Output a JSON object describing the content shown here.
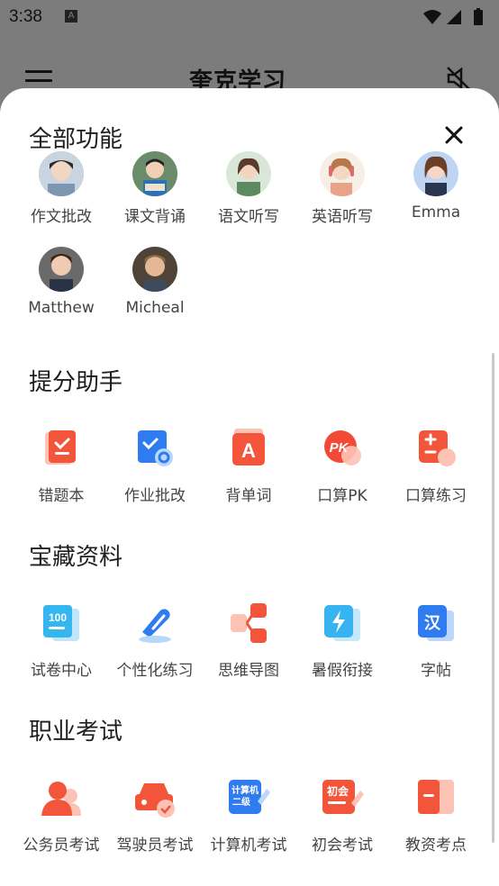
{
  "status_bar": {
    "time": "3:38",
    "notif_badge": "A"
  },
  "app_bar": {
    "title": "奎克学习"
  },
  "sections": {
    "all": {
      "title": "全部功能",
      "items": [
        "作文批改",
        "课文背诵",
        "语文听写",
        "英语听写",
        "Emma",
        "Matthew",
        "Micheal"
      ]
    },
    "boost": {
      "title": "提分助手",
      "items": [
        "错题本",
        "作业批改",
        "背单词",
        "口算PK",
        "口算练习"
      ]
    },
    "treasure": {
      "title": "宝藏资料",
      "items": [
        "试卷中心",
        "个性化练习",
        "思维导图",
        "暑假衔接",
        "字帖"
      ]
    },
    "career": {
      "title": "职业考试",
      "items": [
        "公务员考试",
        "驾驶员考试",
        "计算机考试",
        "初会考试",
        "教资考点"
      ]
    }
  },
  "icon_texts": {
    "kousuan_pk": "PK",
    "shijuan": "100",
    "zitie": "汉",
    "computer": "计算机二级",
    "chuhui": "初会"
  },
  "colors": {
    "accent_red": "#f25a3c",
    "accent_blue": "#2f7bf0",
    "sheet_bg": "#ffffff",
    "dim_bg": "#7a7a7a"
  }
}
